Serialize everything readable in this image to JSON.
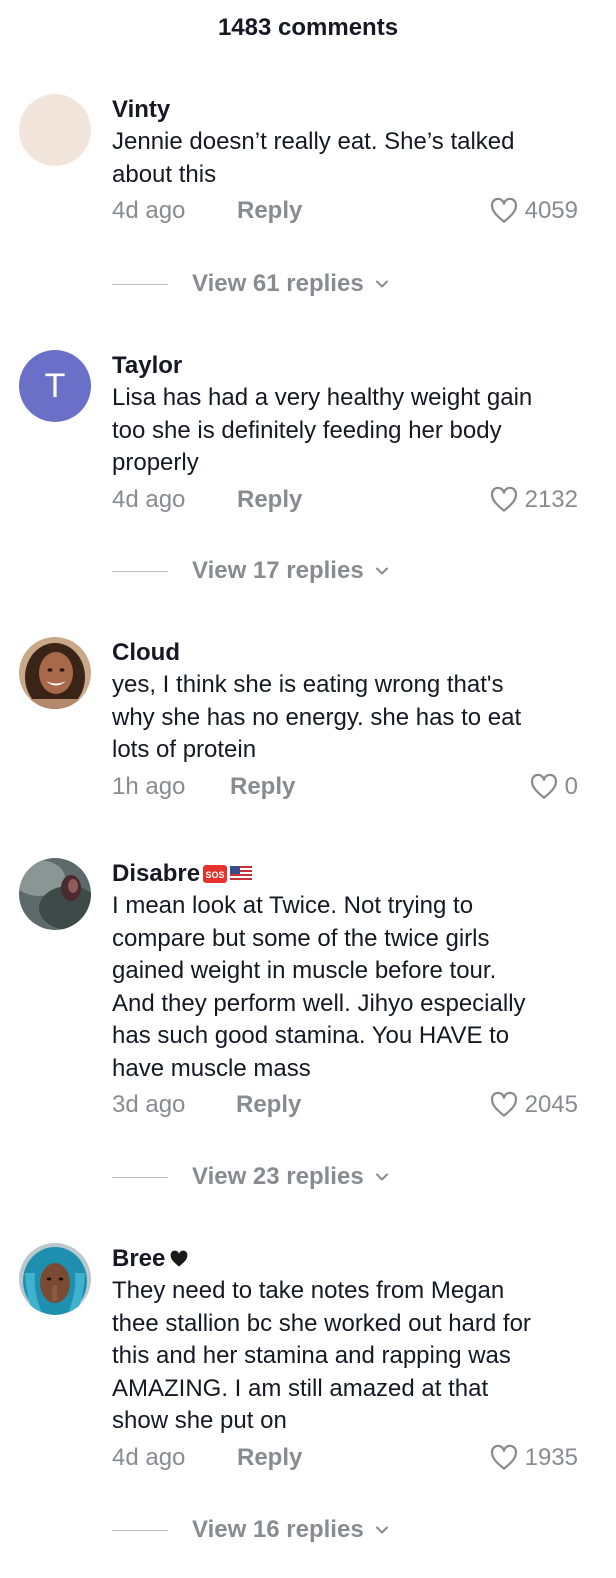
{
  "header": {
    "title": "1483 comments"
  },
  "icons": {
    "like": "heart-outline-icon",
    "expand": "chevron-down-icon"
  },
  "comments": [
    {
      "username": "Vinty",
      "text_lines": [
        "Jennie doesn’t really eat. She’s talked",
        "about this"
      ],
      "time": "4d ago",
      "reply": "Reply",
      "likes": "4059",
      "view_replies": "View 61 replies",
      "avatar": {
        "kind": "plain",
        "color": "#f2e6dc"
      }
    },
    {
      "username": "Taylor",
      "text_lines": [
        "Lisa has had a very healthy weight gain",
        "too she is definitely feeding her body",
        "properly"
      ],
      "time": "4d ago",
      "reply": "Reply",
      "likes": "2132",
      "view_replies": "View 17 replies",
      "avatar": {
        "kind": "letter",
        "letter": "T",
        "color": "#6a6fc8"
      }
    },
    {
      "username": "Cloud",
      "text_lines": [
        "yes, I think she is eating wrong that's",
        "why she has no energy. she has to eat",
        "lots of protein"
      ],
      "time": "1h ago",
      "reply": "Reply",
      "likes": "0",
      "avatar": {
        "kind": "photo"
      }
    },
    {
      "username": "Disabre",
      "username_badges": [
        "sos-emoji",
        "us-flag-emoji"
      ],
      "badge_text": "SOS",
      "text_lines": [
        "I mean look at Twice. Not trying to",
        "compare but some of the twice girls",
        "gained weight in muscle before tour.",
        "And they perform well. Jihyo especially",
        "has such good stamina. You HAVE to",
        "have muscle mass"
      ],
      "time": "3d ago",
      "reply": "Reply",
      "likes": "2045",
      "view_replies": "View 23 replies",
      "avatar": {
        "kind": "photo"
      }
    },
    {
      "username": "Bree",
      "username_badges": [
        "black-heart-emoji"
      ],
      "text_lines": [
        "They need to take notes from Megan",
        "thee stallion bc she worked out hard for",
        "this and her stamina and rapping was",
        "AMAZING. I am still amazed at that",
        "show she put on"
      ],
      "time": "4d ago",
      "reply": "Reply",
      "likes": "1935",
      "view_replies": "View 16 replies",
      "avatar": {
        "kind": "photo"
      }
    }
  ]
}
